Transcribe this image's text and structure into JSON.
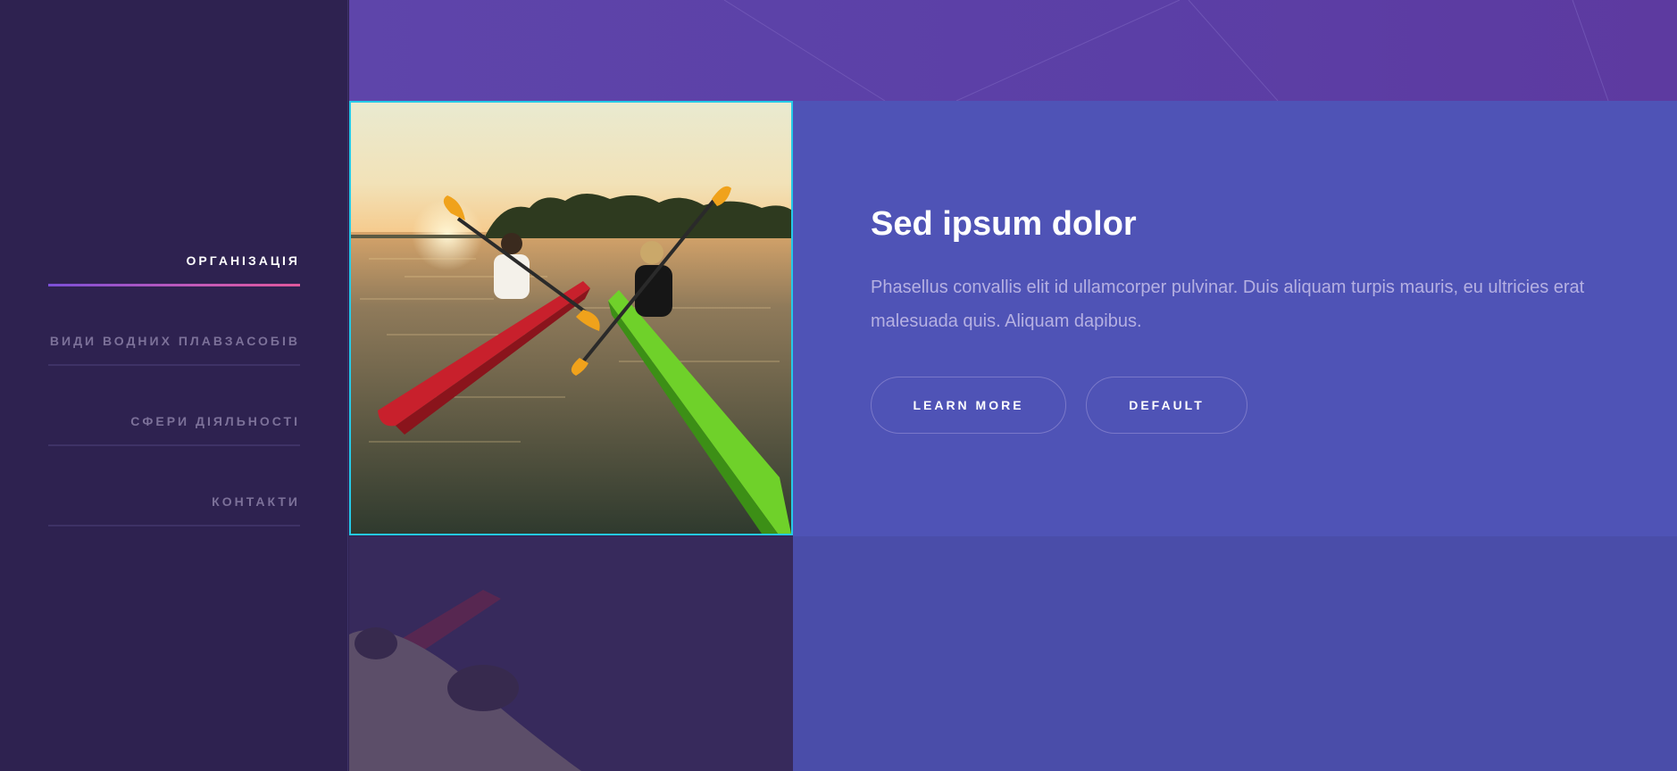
{
  "sidebar": {
    "items": [
      {
        "label": "ОРГАНІЗАЦІЯ",
        "active": true
      },
      {
        "label": "ВИДИ ВОДНИХ ПЛАВЗАСОБІВ",
        "active": false
      },
      {
        "label": "СФЕРИ ДІЯЛЬНОСТІ",
        "active": false
      },
      {
        "label": "КОНТАКТИ",
        "active": false
      }
    ]
  },
  "hero": {
    "title": "Sed ipsum dolor",
    "description": "Phasellus convallis elit id ullamcorper pulvinar. Duis aliquam turpis mauris, eu ultricies erat malesuada quis. Aliquam dapibus.",
    "buttons": {
      "learn_more": "LEARN MORE",
      "default": "DEFAULT"
    },
    "image": {
      "subject": "two kayakers paddling red and green kayaks on a lake at sunset"
    }
  },
  "colors": {
    "sidebar_bg": "#2e2250",
    "header_bg": "#5e45aa",
    "panel_bg": "#4f53b6",
    "accent_border": "#25c9e8",
    "active_underline_start": "#7b4fd8",
    "active_underline_end": "#e0589c"
  }
}
